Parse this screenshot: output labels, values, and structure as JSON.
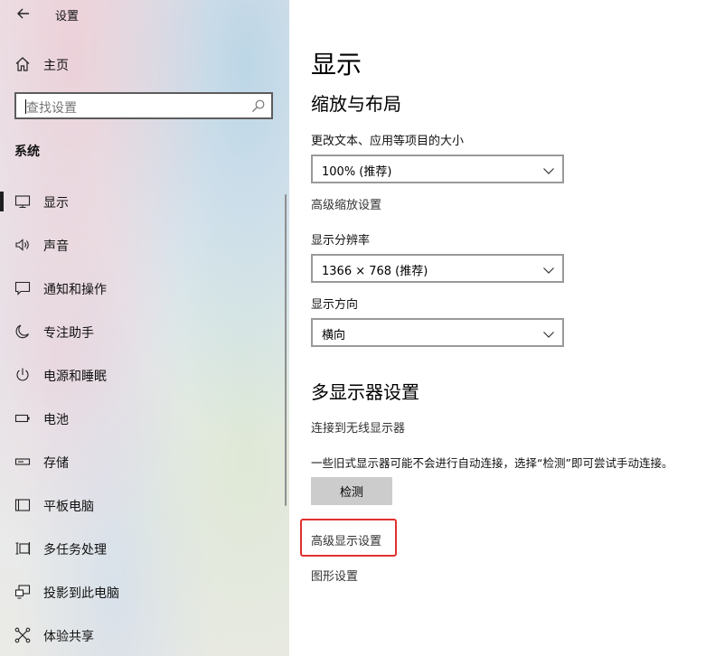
{
  "window": {
    "title": "设置"
  },
  "sidebar": {
    "home_label": "主页",
    "search_placeholder": "查找设置",
    "section_label": "系统",
    "items": [
      {
        "label": "显示",
        "icon": "monitor-icon"
      },
      {
        "label": "声音",
        "icon": "speaker-icon"
      },
      {
        "label": "通知和操作",
        "icon": "notification-icon"
      },
      {
        "label": "专注助手",
        "icon": "moon-icon"
      },
      {
        "label": "电源和睡眠",
        "icon": "power-icon"
      },
      {
        "label": "电池",
        "icon": "battery-icon"
      },
      {
        "label": "存储",
        "icon": "storage-icon"
      },
      {
        "label": "平板电脑",
        "icon": "tablet-icon"
      },
      {
        "label": "多任务处理",
        "icon": "multitask-icon"
      },
      {
        "label": "投影到此电脑",
        "icon": "project-icon"
      },
      {
        "label": "体验共享",
        "icon": "share-icon"
      }
    ],
    "selected_index": 0
  },
  "main": {
    "page_title": "显示",
    "scale_layout": {
      "heading": "缩放与布局",
      "text_size_label": "更改文本、应用等项目的大小",
      "text_size_value": "100% (推荐)",
      "advanced_scaling_link": "高级缩放设置",
      "resolution_label": "显示分辨率",
      "resolution_value": "1366 × 768 (推荐)",
      "orientation_label": "显示方向",
      "orientation_value": "横向"
    },
    "multi_display": {
      "heading": "多显示器设置",
      "wireless_link": "连接到无线显示器",
      "description": "一些旧式显示器可能不会进行自动连接，选择“检测”即可尝试手动连接。",
      "detect_button": "检测",
      "advanced_display_link": "高级显示设置",
      "graphics_link": "图形设置"
    }
  },
  "colors": {
    "highlight_border": "#e03030",
    "button_bg": "#cccccc",
    "dropdown_border": "#999999"
  }
}
